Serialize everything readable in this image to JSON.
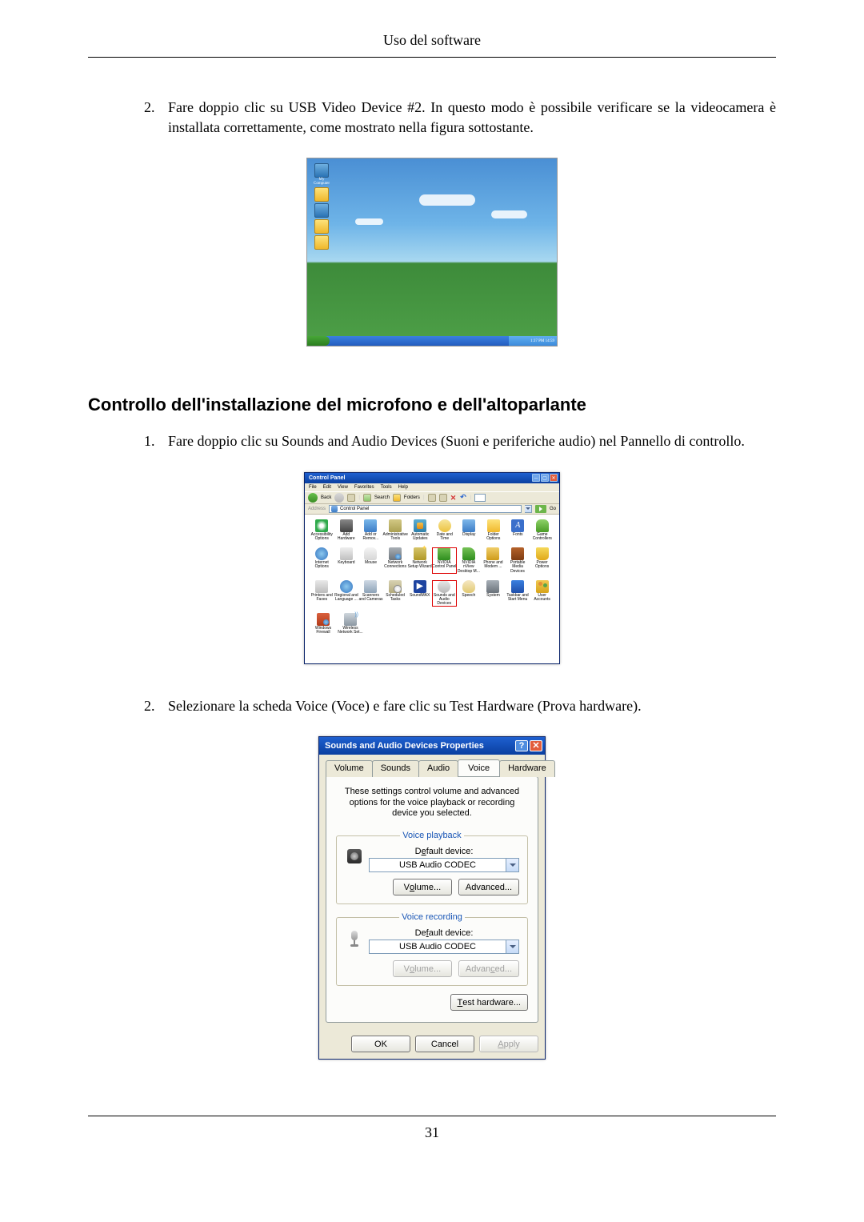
{
  "header": "Uso del software",
  "page_number": "31",
  "step2_top": {
    "number": "2.",
    "text": "Fare doppio clic su USB Video Device #2. In questo modo è possibile verificare se la videocamera è installata correttamente, come mostrato nella figura sottostante."
  },
  "heading2": "Controllo dell'installazione del microfono e dell'altoparlante",
  "step1": {
    "number": "1.",
    "text": "Fare doppio clic su Sounds and Audio Devices (Suoni e periferiche audio) nel Pannello di controllo."
  },
  "step2_bottom": {
    "number": "2.",
    "text": "Selezionare la scheda Voice (Voce) e fare clic su Test Hardware (Prova hardware)."
  },
  "desktop": {
    "icons": [
      "My Computer",
      "",
      "",
      "",
      ""
    ],
    "tray_time": "1:37 PM   14:59"
  },
  "cp": {
    "title": "Control Panel",
    "menu": [
      "File",
      "Edit",
      "View",
      "Favorites",
      "Tools",
      "Help"
    ],
    "toolbar": {
      "back": "Back",
      "search": "Search",
      "folders": "Folders"
    },
    "addr_label": "Address",
    "addr_value": "Control Panel",
    "go": "Go",
    "items": [
      [
        "Accessibility Options",
        "Add Hardware",
        "Add or Remov...",
        "Administrative Tools",
        "Automatic Updates",
        "Date and Time",
        "Display",
        "Folder Options",
        "Fonts",
        "Game Controllers"
      ],
      [
        "Internet Options",
        "Keyboard",
        "Mouse",
        "Network Connections",
        "Network Setup Wizard",
        "NVIDIA Control Panel",
        "NVIDIA nView Desktop M...",
        "Phone and Modem ...",
        "Portable Media Devices",
        "Power Options"
      ],
      [
        "Printers and Faxes",
        "Regional and Language ...",
        "Scanners and Cameras",
        "Scheduled Tasks",
        "SoundMAX",
        "Sounds and Audio Devices",
        "Speech",
        "System",
        "Taskbar and Start Menu",
        "User Accounts"
      ],
      [
        "Windows Firewall",
        "Wireless Network Set..."
      ]
    ]
  },
  "props": {
    "title": "Sounds and Audio Devices Properties",
    "tabs": [
      "Volume",
      "Sounds",
      "Audio",
      "Voice",
      "Hardware"
    ],
    "active_tab": "Voice",
    "desc": "These settings control volume and advanced options for the voice playback or recording device you selected.",
    "group_playback": "Voice playback",
    "group_recording": "Voice recording",
    "default_device_label_prefix": "D",
    "default_device_label_ul": "e",
    "default_device_label_suffix": "fault device:",
    "default_device_label2_prefix": "De",
    "default_device_label2_suffix": "ault device:",
    "default_device_label2_ul": "f",
    "device_value": "USB Audio CODEC",
    "btn_volume_prefix": "V",
    "btn_volume_ul": "o",
    "btn_volume_suffix": "lume...",
    "btn_advanced": "Advanced...",
    "btn_volume2_pref": "V",
    "btn_volume2_ul": "o",
    "btn_volume2_suf": "lume...",
    "btn_advanced2_pref": "Advan",
    "btn_advanced2_ul": "c",
    "btn_advanced2_suf": "ed...",
    "btn_testhw_ul": "T",
    "btn_testhw_suffix": "est hardware...",
    "btn_ok": "OK",
    "btn_cancel": "Cancel",
    "btn_apply_ul": "A",
    "btn_apply_suffix": "pply"
  }
}
